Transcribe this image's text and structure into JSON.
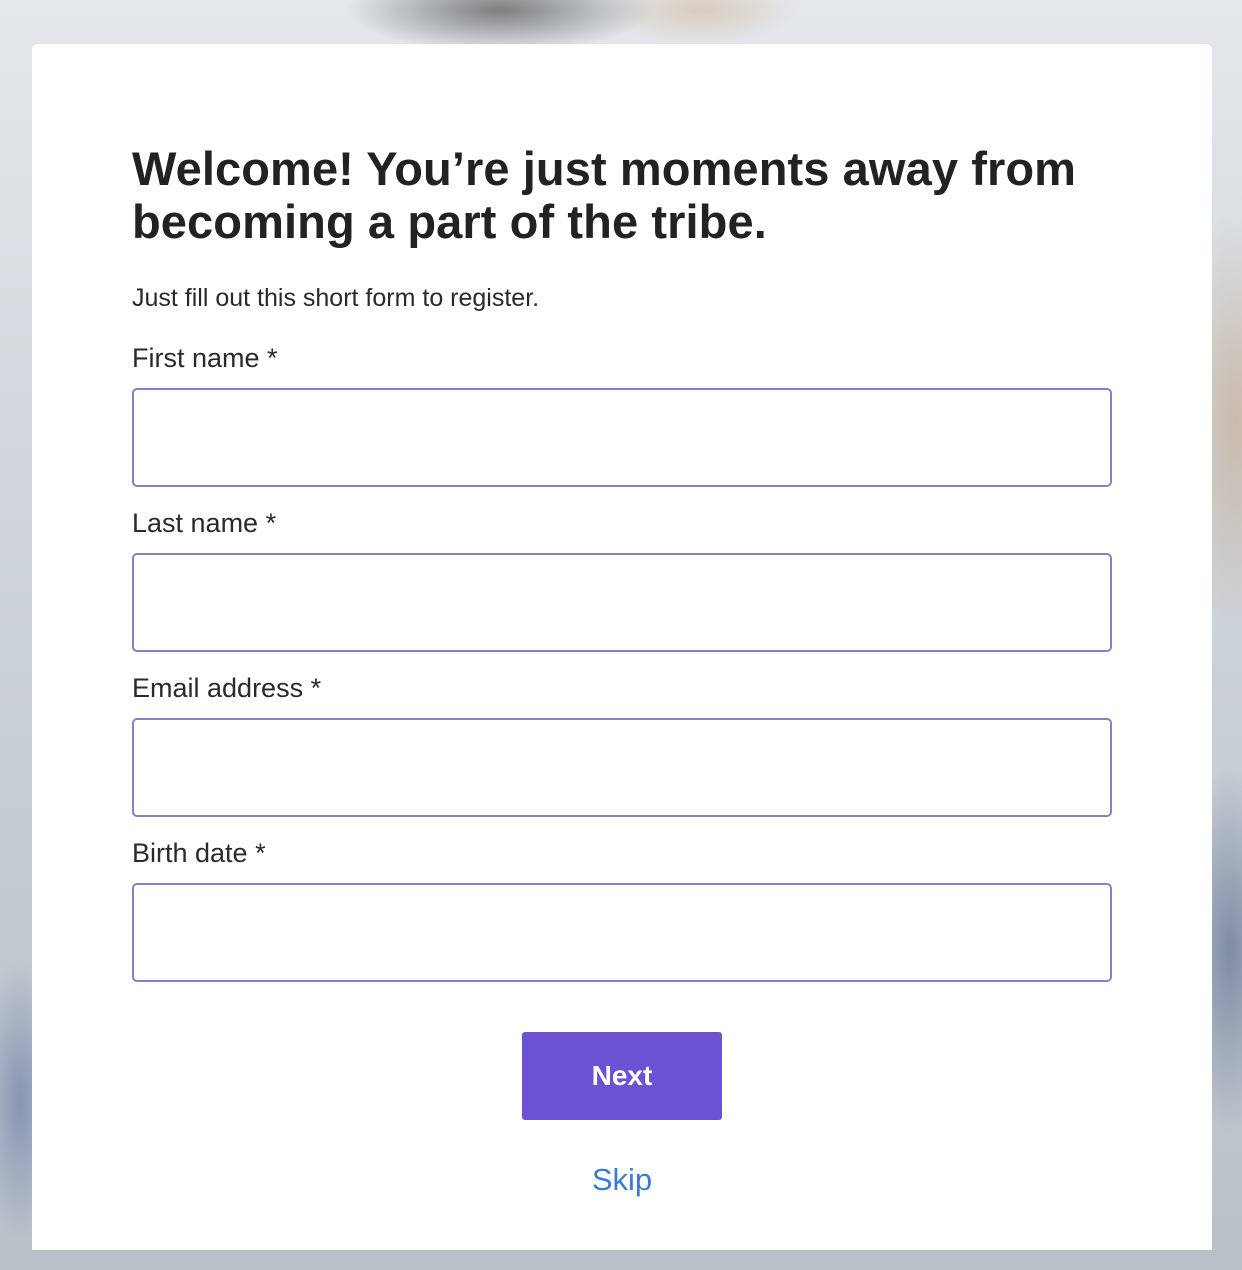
{
  "form": {
    "heading": "Welcome! You’re just moments away from becoming a part of the tribe.",
    "subtitle": "Just fill out this short form to register.",
    "fields": [
      {
        "label": "First name *",
        "value": "",
        "placeholder": ""
      },
      {
        "label": "Last name *",
        "value": "",
        "placeholder": ""
      },
      {
        "label": "Email address *",
        "value": "",
        "placeholder": ""
      },
      {
        "label": "Birth date *",
        "value": "",
        "placeholder": ""
      }
    ],
    "next_label": "Next",
    "skip_label": "Skip"
  },
  "colors": {
    "accent": "#6a52d3",
    "input_border": "#8a7fc7",
    "link": "#3a7bd1",
    "text": "#222222"
  }
}
